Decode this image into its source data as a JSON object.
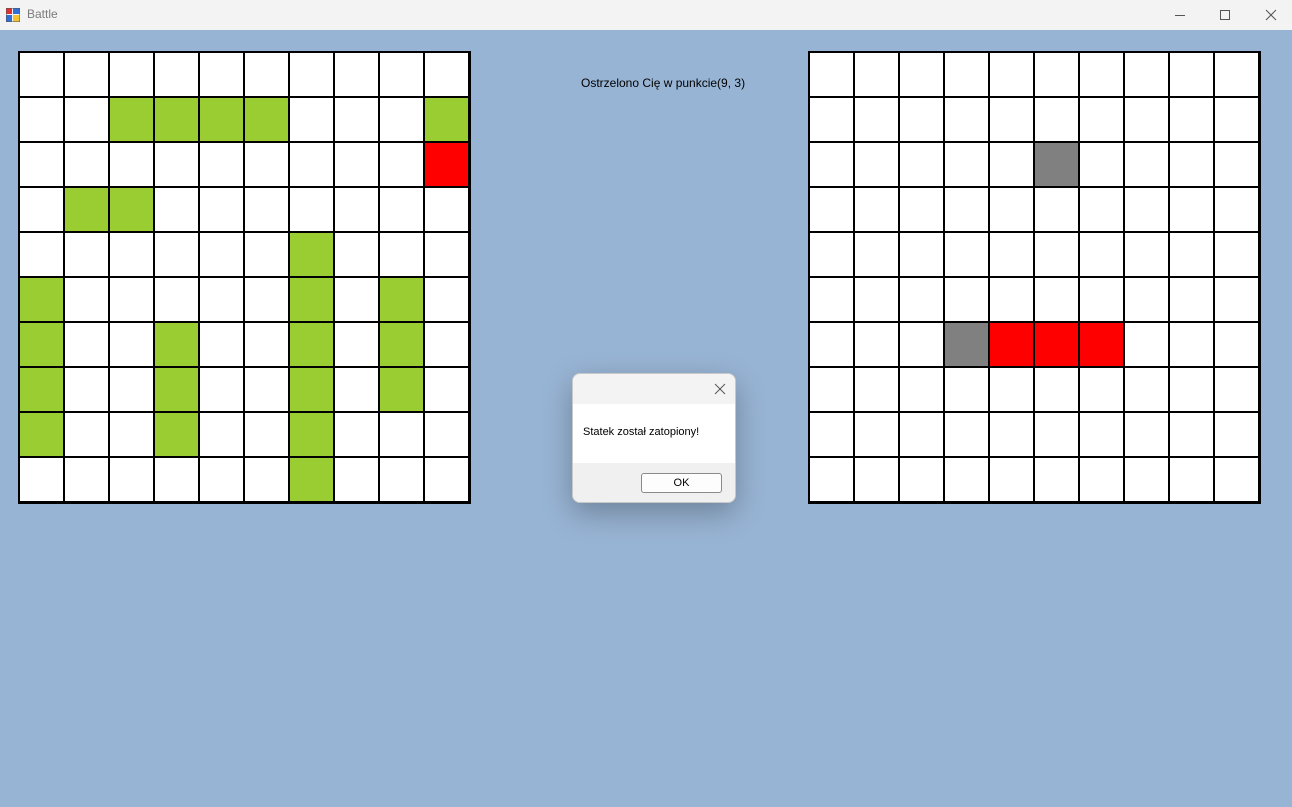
{
  "window": {
    "title": "Battle",
    "buttons": [
      {
        "name": "minimize-button",
        "icon": "minimize-icon"
      },
      {
        "name": "maximize-button",
        "icon": "maximize-icon"
      },
      {
        "name": "close-button",
        "icon": "close-icon"
      }
    ]
  },
  "status_text": "Ostrzelono Cię w punkcie(9, 3)",
  "colors": {
    "background": "#98b4d4",
    "ship": "#9acd32",
    "hit": "#ff0000",
    "miss": "#808080",
    "water": "#ffffff",
    "grid": "#000000"
  },
  "legend": {
    "0": "empty",
    "1": "ship",
    "2": "hit",
    "3": "miss"
  },
  "player_board": [
    [
      0,
      0,
      0,
      0,
      0,
      0,
      0,
      0,
      0,
      0
    ],
    [
      0,
      0,
      1,
      1,
      1,
      1,
      0,
      0,
      0,
      1
    ],
    [
      0,
      0,
      0,
      0,
      0,
      0,
      0,
      0,
      0,
      2
    ],
    [
      0,
      1,
      1,
      0,
      0,
      0,
      0,
      0,
      0,
      0
    ],
    [
      0,
      0,
      0,
      0,
      0,
      0,
      1,
      0,
      0,
      0
    ],
    [
      1,
      0,
      0,
      0,
      0,
      0,
      1,
      0,
      1,
      0
    ],
    [
      1,
      0,
      0,
      1,
      0,
      0,
      1,
      0,
      1,
      0
    ],
    [
      1,
      0,
      0,
      1,
      0,
      0,
      1,
      0,
      1,
      0
    ],
    [
      1,
      0,
      0,
      1,
      0,
      0,
      1,
      0,
      0,
      0
    ],
    [
      0,
      0,
      0,
      0,
      0,
      0,
      1,
      0,
      0,
      0
    ]
  ],
  "enemy_board": [
    [
      0,
      0,
      0,
      0,
      0,
      0,
      0,
      0,
      0,
      0
    ],
    [
      0,
      0,
      0,
      0,
      0,
      0,
      0,
      0,
      0,
      0
    ],
    [
      0,
      0,
      0,
      0,
      0,
      3,
      0,
      0,
      0,
      0
    ],
    [
      0,
      0,
      0,
      0,
      0,
      0,
      0,
      0,
      0,
      0
    ],
    [
      0,
      0,
      0,
      0,
      0,
      0,
      0,
      0,
      0,
      0
    ],
    [
      0,
      0,
      0,
      0,
      0,
      0,
      0,
      0,
      0,
      0
    ],
    [
      0,
      0,
      0,
      3,
      2,
      2,
      2,
      0,
      0,
      0
    ],
    [
      0,
      0,
      0,
      0,
      0,
      0,
      0,
      0,
      0,
      0
    ],
    [
      0,
      0,
      0,
      0,
      0,
      0,
      0,
      0,
      0,
      0
    ],
    [
      0,
      0,
      0,
      0,
      0,
      0,
      0,
      0,
      0,
      0
    ]
  ],
  "dialog": {
    "message": "Statek został zatopiony!",
    "ok_label": "OK",
    "close_icon": "close-icon"
  }
}
